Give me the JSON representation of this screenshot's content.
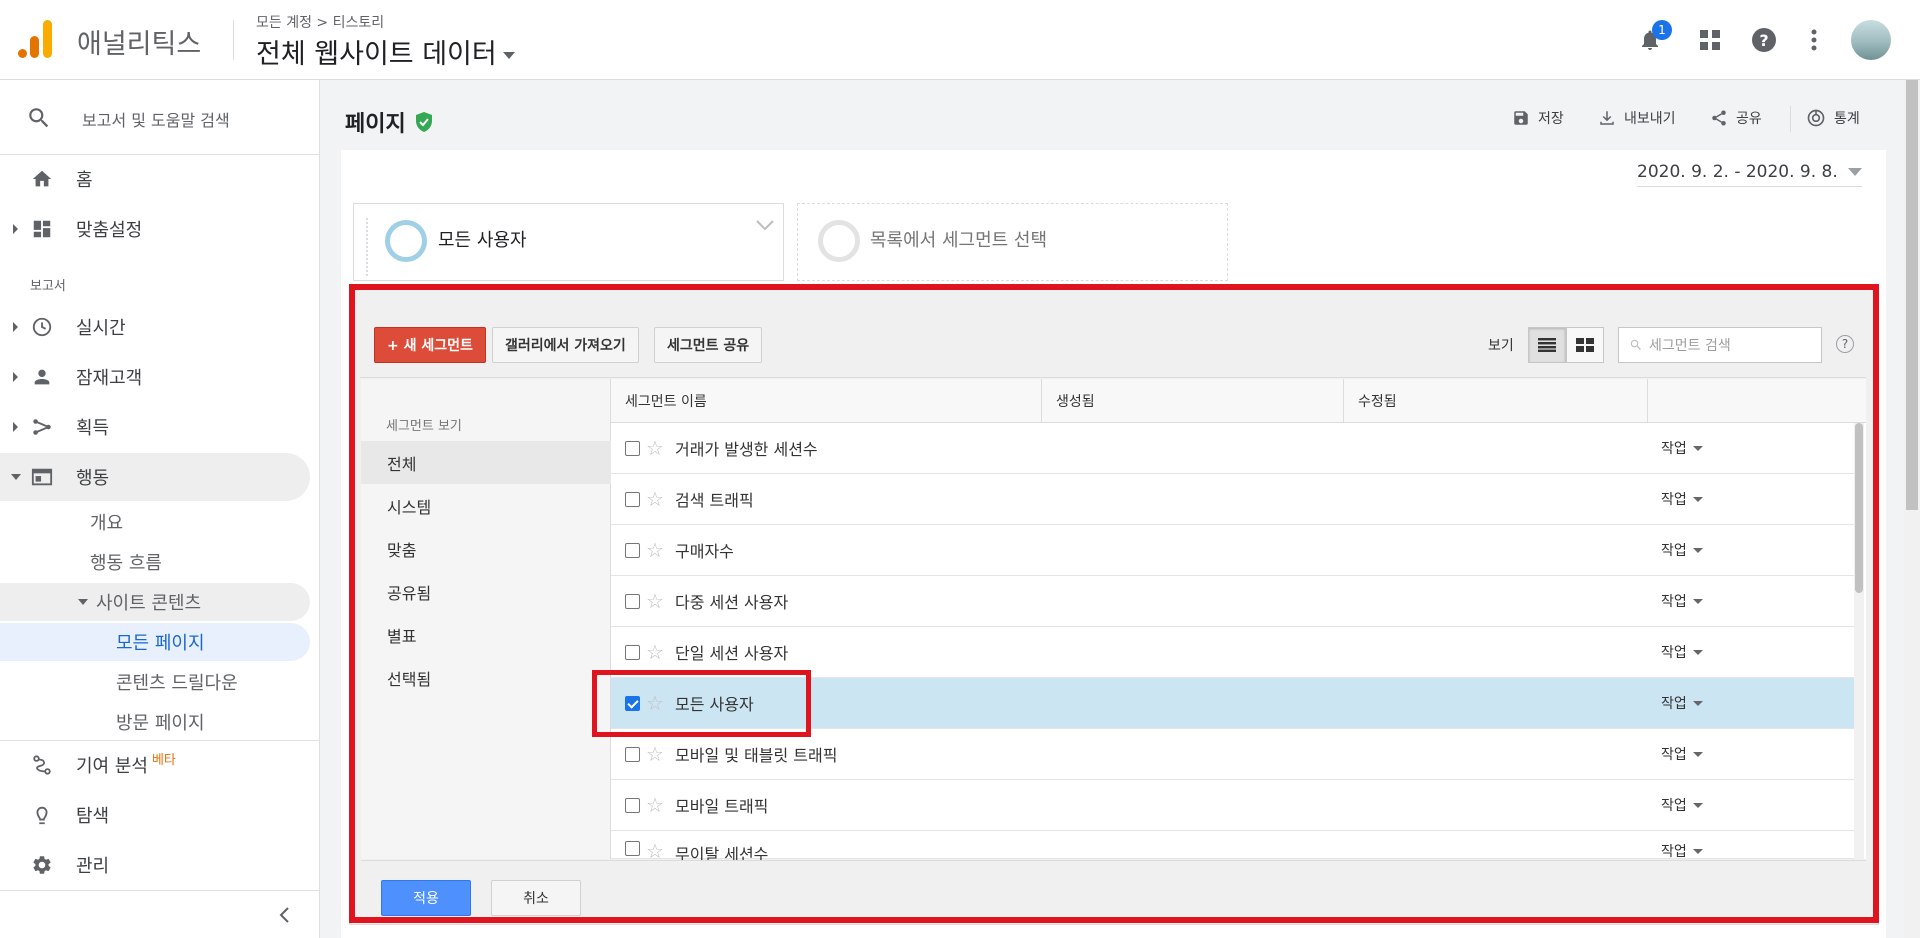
{
  "header": {
    "app_name": "애널리틱스",
    "breadcrumb": "모든 계정 > 티스토리",
    "property": "전체 웹사이트 데이터",
    "notification_count": "1"
  },
  "sidebar": {
    "search_placeholder": "보고서 및 도움말 검색",
    "home": "홈",
    "customization": "맞춤설정",
    "reports_section": "보고서",
    "realtime": "실시간",
    "audience": "잠재고객",
    "acquisition": "획득",
    "behavior": "행동",
    "behavior_sub": {
      "overview": "개요",
      "behavior_flow": "행동 흐름",
      "site_content": "사이트 콘텐츠",
      "all_pages": "모든 페이지",
      "content_drilldown": "콘텐츠 드릴다운",
      "landing_pages": "방문 페이지"
    },
    "attribution": "기여 분석",
    "beta": "베타",
    "discover": "탐색",
    "admin": "관리"
  },
  "page": {
    "title": "페이지",
    "actions": {
      "save": "저장",
      "export": "내보내기",
      "share": "공유",
      "insights": "통계"
    },
    "date_range": "2020. 9. 2. - 2020. 9. 8."
  },
  "segments": {
    "active": "모든 사용자",
    "placeholder": "목록에서 세그먼트 선택"
  },
  "picker": {
    "new_segment": "+ 새 세그먼트",
    "import_gallery": "갤러리에서 가져오기",
    "share_segments": "세그먼트 공유",
    "view_label": "보기",
    "search_placeholder": "세그먼트 검색",
    "help": "?",
    "left_header": "세그먼트 보기",
    "left_items": [
      "전체",
      "시스템",
      "맞춤",
      "공유됨",
      "별표",
      "선택됨"
    ],
    "columns": [
      "세그먼트 이름",
      "생성됨",
      "수정됨"
    ],
    "action_label": "작업",
    "rows": [
      {
        "name": "거래가 발생한 세션수",
        "checked": false
      },
      {
        "name": "검색 트래픽",
        "checked": false
      },
      {
        "name": "구매자수",
        "checked": false
      },
      {
        "name": "다중 세션 사용자",
        "checked": false
      },
      {
        "name": "단일 세션 사용자",
        "checked": false
      },
      {
        "name": "모든 사용자",
        "checked": true
      },
      {
        "name": "모바일 및 태블릿 트래픽",
        "checked": false
      },
      {
        "name": "모바일 트래픽",
        "checked": false
      },
      {
        "name": "무이탈 세션수",
        "checked": false
      }
    ],
    "apply": "적용",
    "cancel": "취소"
  },
  "colors": {
    "highlight_box": "#e0141e",
    "new_segment_button": "#dd4b39",
    "apply_button": "#4d90fe",
    "selected_row": "#cce5f3"
  }
}
